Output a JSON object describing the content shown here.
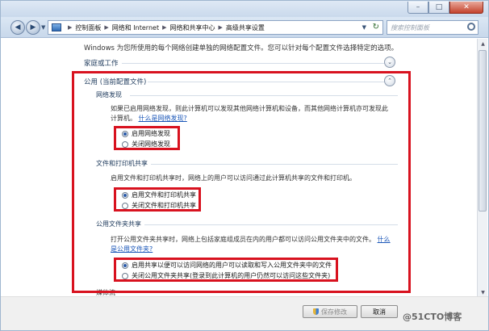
{
  "window": {
    "minimize_glyph": "–",
    "maximize_glyph": "□",
    "close_glyph": "✕"
  },
  "nav": {
    "back_glyph": "◀",
    "forward_glyph": "▶",
    "dropdown_glyph": "▼",
    "breadcrumb": [
      "控制面板",
      "网络和 Internet",
      "网络和共享中心",
      "高级共享设置"
    ],
    "separator": "▶",
    "refresh_glyph": "↻",
    "search_placeholder": "搜索控制面板"
  },
  "content": {
    "intro": "Windows 为您所使用的每个网络创建单独的网络配置文件。您可以针对每个配置文件选择特定的选项。",
    "profile_home": {
      "label": "家庭或工作",
      "chevron": "⌄"
    },
    "profile_public": {
      "label": "公用 (当前配置文件)",
      "chevron": "⌃",
      "network_discovery": {
        "heading": "网络发现",
        "description_line1": "如果已启用网络发现，则此计算机可以发现其他网络计算机和设备，而其他网络计算机亦可发现此",
        "description_line2": "计算机。",
        "link": "什么是网络发现?",
        "options": [
          "启用网络发现",
          "关闭网络发现"
        ],
        "selected_index": 0
      },
      "file_printer_sharing": {
        "heading": "文件和打印机共享",
        "description": "启用文件和打印机共享时，网络上的用户可以访问通过此计算机共享的文件和打印机。",
        "options": [
          "启用文件和打印机共享",
          "关闭文件和打印机共享"
        ],
        "selected_index": 0
      },
      "public_folder_sharing": {
        "heading": "公用文件夹共享",
        "description": "打开公用文件夹共享时，网络上包括家庭组成员在内的用户都可以访问公用文件夹中的文件。",
        "link_line1": "什么",
        "link_line2": "是公用文件夹?",
        "options": [
          "启用共享以便可以访问网络的用户可以读取和写入公用文件夹中的文件",
          "关闭公用文件夹共享(登录到此计算机的用户仍然可以访问这些文件夹)"
        ],
        "selected_index": 0
      },
      "next_heading": "媒体流"
    }
  },
  "scrollbar": {
    "up_glyph": "▲",
    "down_glyph": "▼"
  },
  "footer": {
    "save_label": "保存修改",
    "cancel_label": "取消",
    "watermark": "@51CTO博客"
  },
  "colors": {
    "highlight_box": "#d8121f",
    "link": "#1a56b8",
    "heading": "#1e3a5c"
  }
}
